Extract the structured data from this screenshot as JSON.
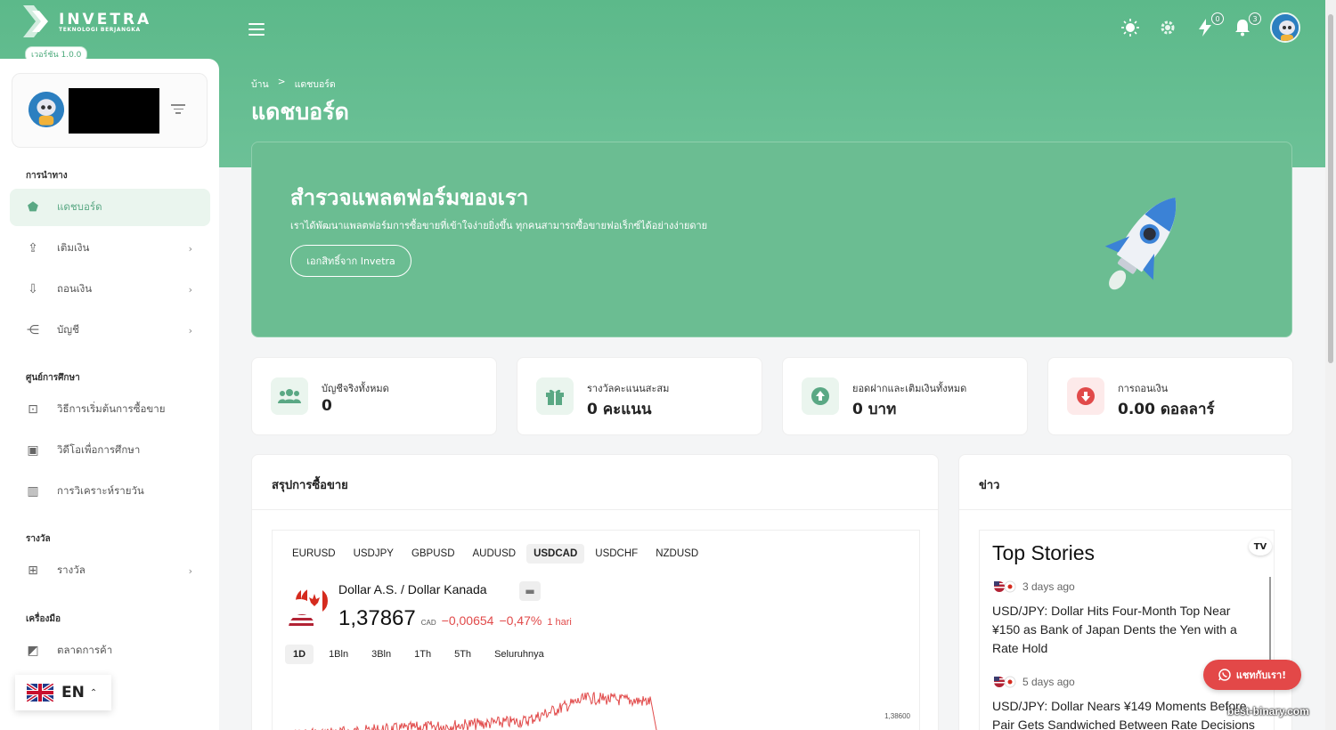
{
  "brand": {
    "name": "INVETRA",
    "tagline": "TEKNOLOGI BERJANGKA",
    "version": "เวอร์ชัน 1.0.0"
  },
  "header": {
    "notifications_lightning_count": "0",
    "notifications_bell_count": "3"
  },
  "sidebar": {
    "sections": {
      "navigation": "การนำทาง",
      "education": "ศูนย์การศึกษา",
      "rewards": "รางวัล",
      "tools": "เครื่องมือ"
    },
    "items": [
      {
        "label": "แดชบอร์ด",
        "icon": "home-icon"
      },
      {
        "label": "เติมเงิน",
        "icon": "upload-icon"
      },
      {
        "label": "ถอนเงิน",
        "icon": "download-icon"
      },
      {
        "label": "บัญชี",
        "icon": "accounts-icon"
      },
      {
        "label": "วิธีการเริ่มต้นการซื้อขาย",
        "icon": "presentation-icon"
      },
      {
        "label": "วิดีโอเพื่อการศึกษา",
        "icon": "video-icon"
      },
      {
        "label": "การวิเคราะห์รายวัน",
        "icon": "bar-chart-icon"
      },
      {
        "label": "รางวัล",
        "icon": "gift-icon"
      },
      {
        "label": "ตลาดการค้า",
        "icon": "market-icon"
      }
    ],
    "language": "EN"
  },
  "breadcrumb": {
    "home": "บ้าน",
    "separator": ">",
    "current": "แดชบอร์ด"
  },
  "page_title": "แดชบอร์ด",
  "hero": {
    "title": "สำรวจแพลตฟอร์มของเรา",
    "description": "เราได้พัฒนาแพลตฟอร์มการซื้อขายที่เข้าใจง่ายยิ่งขึ้น ทุกคนสามารถซื้อขายฟอเร็กซ์ได้อย่างง่ายดาย",
    "button": "เอกสิทธิ์จาก Invetra"
  },
  "stats": [
    {
      "label": "บัญชีจริงทั้งหมด",
      "value": "0",
      "icon": "users-icon",
      "color": "#5aa884",
      "bg": "#eaf5ee"
    },
    {
      "label": "รางวัลคะแนนสะสม",
      "value": "0 คะแนน",
      "icon": "gift-icon",
      "color": "#5aa884",
      "bg": "#eaf5ee"
    },
    {
      "label": "ยอดฝากและเติมเงินทั้งหมด",
      "value": "0 บาท",
      "icon": "arrow-up-circle-icon",
      "color": "#5aa884",
      "bg": "#eaf5ee"
    },
    {
      "label": "การถอนเงิน",
      "value": "0.00 ดอลลาร์",
      "icon": "arrow-down-circle-icon",
      "color": "#e14a4a",
      "bg": "#fdeaea"
    }
  ],
  "summary": {
    "title": "สรุปการซื้อขาย",
    "tabs": [
      "EURUSD",
      "USDJPY",
      "GBPUSD",
      "AUDUSD",
      "USDCAD",
      "USDCHF",
      "NZDUSD"
    ],
    "active_tab": "USDCAD",
    "pair_name": "Dollar A.S. / Dollar Kanada",
    "price": "1,37867",
    "currency": "CAD",
    "change": "−0,00654",
    "change_pct": "−0,47%",
    "period": "1 hari",
    "ranges": [
      "1D",
      "1Bln",
      "3Bln",
      "1Th",
      "5Th",
      "Seluruhnya"
    ],
    "active_range": "1D",
    "axis_label": "1,38600"
  },
  "news": {
    "title": "ข่าว",
    "widget_title": "Top Stories",
    "stories": [
      {
        "time": "3 days ago",
        "title": "USD/JPY: Dollar Hits Four-Month Top Near ¥150 as Bank of Japan Dents the Yen with a Rate Hold"
      },
      {
        "time": "5 days ago",
        "title": "USD/JPY: Dollar Nears ¥149 Moments Before Pair Gets Sandwiched Between Rate Decisions"
      }
    ]
  },
  "chat_button": "แชทกับเรา!",
  "watermark": "best-binary.com"
}
